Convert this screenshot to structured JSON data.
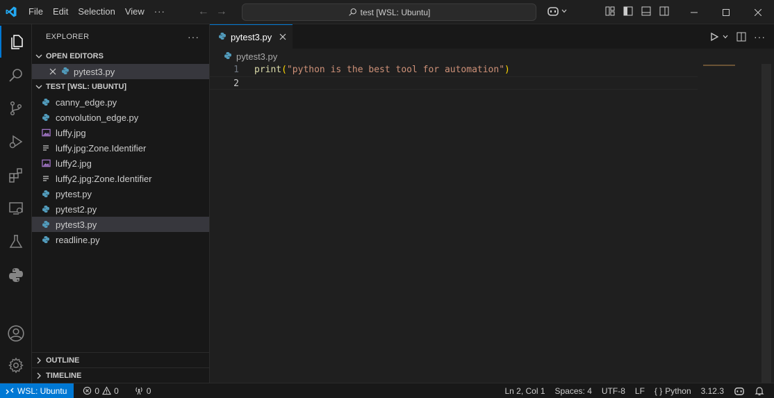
{
  "menu": [
    "File",
    "Edit",
    "Selection",
    "View"
  ],
  "command_center": {
    "label": "test [WSL: Ubuntu]"
  },
  "sidebar": {
    "title": "EXPLORER",
    "open_editors_label": "OPEN EDITORS",
    "open_editor_file": "pytest3.py",
    "workspace_label": "TEST [WSL: UBUNTU]",
    "files": [
      {
        "name": "canny_edge.py",
        "type": "python"
      },
      {
        "name": "convolution_edge.py",
        "type": "python"
      },
      {
        "name": "luffy.jpg",
        "type": "image"
      },
      {
        "name": "luffy.jpg:Zone.Identifier",
        "type": "text"
      },
      {
        "name": "luffy2.jpg",
        "type": "image"
      },
      {
        "name": "luffy2.jpg:Zone.Identifier",
        "type": "text"
      },
      {
        "name": "pytest.py",
        "type": "python"
      },
      {
        "name": "pytest2.py",
        "type": "python"
      },
      {
        "name": "pytest3.py",
        "type": "python",
        "selected": true
      },
      {
        "name": "readline.py",
        "type": "python"
      }
    ],
    "outline_label": "OUTLINE",
    "timeline_label": "TIMELINE"
  },
  "editor": {
    "tab_label": "pytest3.py",
    "breadcrumb": "pytest3.py",
    "lines": [
      {
        "num": "1",
        "fn": "print",
        "open": "(",
        "str": "\"python is the best tool for automation\"",
        "close": ")"
      },
      {
        "num": "2",
        "fn": "",
        "open": "",
        "str": "",
        "close": ""
      }
    ]
  },
  "statusbar": {
    "remote": "WSL: Ubuntu",
    "errors": "0",
    "warnings": "0",
    "ports": "0",
    "position": "Ln 2, Col 1",
    "spaces": "Spaces: 4",
    "encoding": "UTF-8",
    "eol": "LF",
    "language": "Python",
    "python_version": "3.12.3"
  },
  "colors": {
    "accent": "#0078d4",
    "python_icon": "#519aba",
    "image_icon": "#a074c4"
  }
}
